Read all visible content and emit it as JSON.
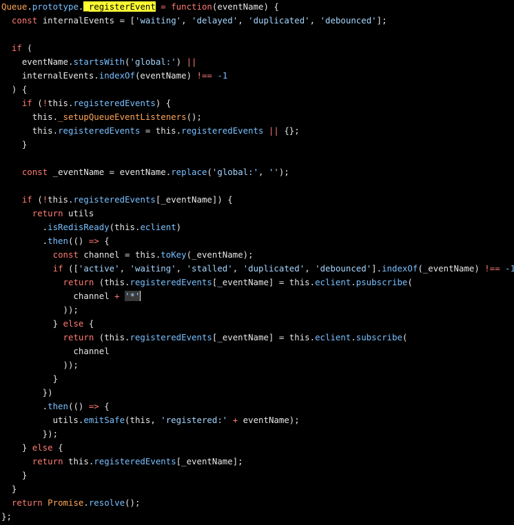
{
  "editor": {
    "lines": [
      [
        {
          "t": "Queue",
          "c": "cls"
        },
        {
          "t": ".",
          "c": "punc"
        },
        {
          "t": "prototype",
          "c": "prop"
        },
        {
          "t": ".",
          "c": "punc"
        },
        {
          "t": "_registerEvent",
          "c": "search"
        },
        {
          "t": " = ",
          "c": "op"
        },
        {
          "t": "function",
          "c": "kw"
        },
        {
          "t": "(eventName) {",
          "c": "plain"
        }
      ],
      [
        {
          "t": "  ",
          "c": "plain"
        },
        {
          "t": "const",
          "c": "kw"
        },
        {
          "t": " internalEvents = [",
          "c": "plain"
        },
        {
          "t": "'waiting'",
          "c": "str"
        },
        {
          "t": ", ",
          "c": "plain"
        },
        {
          "t": "'delayed'",
          "c": "str"
        },
        {
          "t": ", ",
          "c": "plain"
        },
        {
          "t": "'duplicated'",
          "c": "str"
        },
        {
          "t": ", ",
          "c": "plain"
        },
        {
          "t": "'debounced'",
          "c": "str"
        },
        {
          "t": "];",
          "c": "plain"
        }
      ],
      [],
      [
        {
          "t": "  ",
          "c": "plain"
        },
        {
          "t": "if",
          "c": "kw"
        },
        {
          "t": " (",
          "c": "plain"
        }
      ],
      [
        {
          "t": "    eventName.",
          "c": "plain"
        },
        {
          "t": "startsWith",
          "c": "prop"
        },
        {
          "t": "(",
          "c": "plain"
        },
        {
          "t": "'global:'",
          "c": "str"
        },
        {
          "t": ") ",
          "c": "plain"
        },
        {
          "t": "||",
          "c": "op"
        }
      ],
      [
        {
          "t": "    internalEvents.",
          "c": "plain"
        },
        {
          "t": "indexOf",
          "c": "prop"
        },
        {
          "t": "(eventName) ",
          "c": "plain"
        },
        {
          "t": "!==",
          "c": "op"
        },
        {
          "t": " ",
          "c": "plain"
        },
        {
          "t": "-1",
          "c": "num"
        }
      ],
      [
        {
          "t": "  ) {",
          "c": "plain"
        }
      ],
      [
        {
          "t": "    ",
          "c": "plain"
        },
        {
          "t": "if",
          "c": "kw"
        },
        {
          "t": " (",
          "c": "plain"
        },
        {
          "t": "!",
          "c": "op"
        },
        {
          "t": "this.",
          "c": "plain"
        },
        {
          "t": "registeredEvents",
          "c": "prop"
        },
        {
          "t": ") {",
          "c": "plain"
        }
      ],
      [
        {
          "t": "      this.",
          "c": "plain"
        },
        {
          "t": "_setupQueueEventListeners",
          "c": "cls"
        },
        {
          "t": "();",
          "c": "plain"
        }
      ],
      [
        {
          "t": "      this.",
          "c": "plain"
        },
        {
          "t": "registeredEvents",
          "c": "prop"
        },
        {
          "t": " = this.",
          "c": "plain"
        },
        {
          "t": "registeredEvents",
          "c": "prop"
        },
        {
          "t": " ",
          "c": "plain"
        },
        {
          "t": "||",
          "c": "op"
        },
        {
          "t": " {};",
          "c": "plain"
        }
      ],
      [
        {
          "t": "    }",
          "c": "plain"
        }
      ],
      [],
      [
        {
          "t": "    ",
          "c": "plain"
        },
        {
          "t": "const",
          "c": "kw"
        },
        {
          "t": " _eventName = eventName.",
          "c": "plain"
        },
        {
          "t": "replace",
          "c": "prop"
        },
        {
          "t": "(",
          "c": "plain"
        },
        {
          "t": "'global:'",
          "c": "str"
        },
        {
          "t": ", ",
          "c": "plain"
        },
        {
          "t": "''",
          "c": "str"
        },
        {
          "t": ");",
          "c": "plain"
        }
      ],
      [],
      [
        {
          "t": "    ",
          "c": "plain"
        },
        {
          "t": "if",
          "c": "kw"
        },
        {
          "t": " (",
          "c": "plain"
        },
        {
          "t": "!",
          "c": "op"
        },
        {
          "t": "this.",
          "c": "plain"
        },
        {
          "t": "registeredEvents",
          "c": "prop"
        },
        {
          "t": "[_eventName]) {",
          "c": "plain"
        }
      ],
      [
        {
          "t": "      ",
          "c": "plain"
        },
        {
          "t": "return",
          "c": "kw"
        },
        {
          "t": " utils",
          "c": "plain"
        }
      ],
      [
        {
          "t": "        .",
          "c": "plain"
        },
        {
          "t": "isRedisReady",
          "c": "prop"
        },
        {
          "t": "(this.",
          "c": "plain"
        },
        {
          "t": "eclient",
          "c": "prop"
        },
        {
          "t": ")",
          "c": "plain"
        }
      ],
      [
        {
          "t": "        .",
          "c": "plain"
        },
        {
          "t": "then",
          "c": "prop"
        },
        {
          "t": "(() ",
          "c": "plain"
        },
        {
          "t": "=>",
          "c": "op"
        },
        {
          "t": " {",
          "c": "plain"
        }
      ],
      [
        {
          "t": "          ",
          "c": "plain"
        },
        {
          "t": "const",
          "c": "kw"
        },
        {
          "t": " channel = this.",
          "c": "plain"
        },
        {
          "t": "toKey",
          "c": "prop"
        },
        {
          "t": "(_eventName);",
          "c": "plain"
        }
      ],
      [
        {
          "t": "          ",
          "c": "plain"
        },
        {
          "t": "if",
          "c": "kw"
        },
        {
          "t": " ([",
          "c": "plain"
        },
        {
          "t": "'active'",
          "c": "str"
        },
        {
          "t": ", ",
          "c": "plain"
        },
        {
          "t": "'waiting'",
          "c": "str"
        },
        {
          "t": ", ",
          "c": "plain"
        },
        {
          "t": "'stalled'",
          "c": "str"
        },
        {
          "t": ", ",
          "c": "plain"
        },
        {
          "t": "'duplicated'",
          "c": "str"
        },
        {
          "t": ", ",
          "c": "plain"
        },
        {
          "t": "'debounced'",
          "c": "str"
        },
        {
          "t": "].",
          "c": "plain"
        },
        {
          "t": "indexOf",
          "c": "prop"
        },
        {
          "t": "(_eventName) ",
          "c": "plain"
        },
        {
          "t": "!==",
          "c": "op"
        },
        {
          "t": " ",
          "c": "plain"
        },
        {
          "t": "-1",
          "c": "num"
        },
        {
          "t": ") {",
          "c": "plain"
        }
      ],
      [
        {
          "t": "            ",
          "c": "plain"
        },
        {
          "t": "return",
          "c": "kw"
        },
        {
          "t": " (this.",
          "c": "plain"
        },
        {
          "t": "registeredEvents",
          "c": "prop"
        },
        {
          "t": "[_eventName] = this.",
          "c": "plain"
        },
        {
          "t": "eclient",
          "c": "prop"
        },
        {
          "t": ".",
          "c": "plain"
        },
        {
          "t": "psubscribe",
          "c": "prop"
        },
        {
          "t": "(",
          "c": "plain"
        }
      ],
      [
        {
          "t": "              channel ",
          "c": "plain"
        },
        {
          "t": "+",
          "c": "op"
        },
        {
          "t": " ",
          "c": "plain"
        },
        {
          "t": "'*'",
          "c": "sel"
        },
        {
          "t": "",
          "c": "cursor"
        }
      ],
      [
        {
          "t": "            ));",
          "c": "plain"
        }
      ],
      [
        {
          "t": "          } ",
          "c": "plain"
        },
        {
          "t": "else",
          "c": "kw"
        },
        {
          "t": " {",
          "c": "plain"
        }
      ],
      [
        {
          "t": "            ",
          "c": "plain"
        },
        {
          "t": "return",
          "c": "kw"
        },
        {
          "t": " (this.",
          "c": "plain"
        },
        {
          "t": "registeredEvents",
          "c": "prop"
        },
        {
          "t": "[_eventName] = this.",
          "c": "plain"
        },
        {
          "t": "eclient",
          "c": "prop"
        },
        {
          "t": ".",
          "c": "plain"
        },
        {
          "t": "subscribe",
          "c": "prop"
        },
        {
          "t": "(",
          "c": "plain"
        }
      ],
      [
        {
          "t": "              channel",
          "c": "plain"
        }
      ],
      [
        {
          "t": "            ));",
          "c": "plain"
        }
      ],
      [
        {
          "t": "          }",
          "c": "plain"
        }
      ],
      [
        {
          "t": "        })",
          "c": "plain"
        }
      ],
      [
        {
          "t": "        .",
          "c": "plain"
        },
        {
          "t": "then",
          "c": "prop"
        },
        {
          "t": "(() ",
          "c": "plain"
        },
        {
          "t": "=>",
          "c": "op"
        },
        {
          "t": " {",
          "c": "plain"
        }
      ],
      [
        {
          "t": "          utils.",
          "c": "plain"
        },
        {
          "t": "emitSafe",
          "c": "prop"
        },
        {
          "t": "(this, ",
          "c": "plain"
        },
        {
          "t": "'registered:'",
          "c": "str"
        },
        {
          "t": " ",
          "c": "plain"
        },
        {
          "t": "+",
          "c": "op"
        },
        {
          "t": " eventName);",
          "c": "plain"
        }
      ],
      [
        {
          "t": "        });",
          "c": "plain"
        }
      ],
      [
        {
          "t": "    } ",
          "c": "plain"
        },
        {
          "t": "else",
          "c": "kw"
        },
        {
          "t": " {",
          "c": "plain"
        }
      ],
      [
        {
          "t": "      ",
          "c": "plain"
        },
        {
          "t": "return",
          "c": "kw"
        },
        {
          "t": " this.",
          "c": "plain"
        },
        {
          "t": "registeredEvents",
          "c": "prop"
        },
        {
          "t": "[_eventName];",
          "c": "plain"
        }
      ],
      [
        {
          "t": "    }",
          "c": "plain"
        }
      ],
      [
        {
          "t": "  }",
          "c": "plain"
        }
      ],
      [
        {
          "t": "  ",
          "c": "plain"
        },
        {
          "t": "return",
          "c": "kw"
        },
        {
          "t": " ",
          "c": "plain"
        },
        {
          "t": "Promise",
          "c": "cls"
        },
        {
          "t": ".",
          "c": "plain"
        },
        {
          "t": "resolve",
          "c": "prop"
        },
        {
          "t": "();",
          "c": "plain"
        }
      ],
      [
        {
          "t": "};",
          "c": "plain"
        }
      ]
    ]
  },
  "colors": {
    "background": "#000000",
    "search_highlight": "#ffff33",
    "selection": "#3a3a3a"
  }
}
